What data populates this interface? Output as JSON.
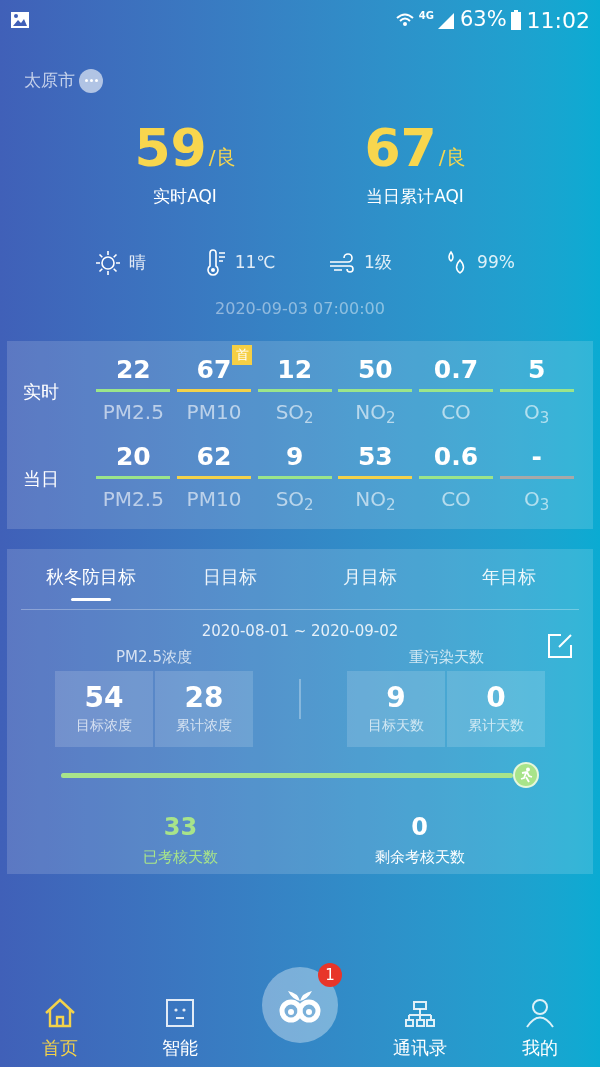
{
  "status_bar": {
    "network": "4G",
    "battery": "63%",
    "time": "11:02"
  },
  "city": {
    "name": "太原市"
  },
  "aqi": [
    {
      "value": "59",
      "grade": "/良",
      "label": "实时AQI"
    },
    {
      "value": "67",
      "grade": "/良",
      "label": "当日累计AQI"
    }
  ],
  "weather": [
    {
      "kind": "sun",
      "text": "晴"
    },
    {
      "kind": "temp",
      "text": "11℃"
    },
    {
      "kind": "wind",
      "text": "1级"
    },
    {
      "kind": "humidity",
      "text": "99%"
    }
  ],
  "timestamp": "2020-09-03 07:00:00",
  "pollutants": [
    {
      "label": "实时",
      "items": [
        {
          "value": "22",
          "name": "PM2.5",
          "color": "#9be58a"
        },
        {
          "value": "67",
          "name": "PM10",
          "color": "#f3d24a",
          "badge": "首"
        },
        {
          "value": "12",
          "name": "SO$_{2}$",
          "color": "#9be58a"
        },
        {
          "value": "50",
          "name": "NO$_{2}$",
          "color": "#9be58a"
        },
        {
          "value": "0.7",
          "name": "CO",
          "color": "#9be58a"
        },
        {
          "value": "5",
          "name": "O$_{3}$",
          "color": "#9be58a"
        }
      ]
    },
    {
      "label": "当日",
      "items": [
        {
          "value": "20",
          "name": "PM2.5",
          "color": "#9be58a"
        },
        {
          "value": "62",
          "name": "PM10",
          "color": "#f3d24a"
        },
        {
          "value": "9",
          "name": "SO$_{2}$",
          "color": "#9be58a"
        },
        {
          "value": "53",
          "name": "NO$_{2}$",
          "color": "#f3d24a"
        },
        {
          "value": "0.6",
          "name": "CO",
          "color": "#9be58a"
        },
        {
          "value": "-",
          "name": "O$_{3}$",
          "color": "#a8a8a8"
        }
      ]
    }
  ],
  "goal_tabs": [
    {
      "label": "秋冬防目标",
      "selected": true
    },
    {
      "label": "日目标",
      "selected": false
    },
    {
      "label": "月目标",
      "selected": false
    },
    {
      "label": "年目标",
      "selected": false
    }
  ],
  "period": "2020-08-01 ~ 2020-09-02",
  "groups": [
    {
      "title": "PM2.5浓度",
      "boxes": [
        {
          "value": "54",
          "label": "目标浓度"
        },
        {
          "value": "28",
          "label": "累计浓度"
        }
      ]
    },
    {
      "title": "重污染天数",
      "boxes": [
        {
          "value": "9",
          "label": "目标天数"
        },
        {
          "value": "0",
          "label": "累计天数"
        }
      ]
    }
  ],
  "progress": {
    "level": 1
  },
  "days": [
    {
      "kind": "done",
      "value": "33",
      "label": "已考核天数"
    },
    {
      "kind": "remaining",
      "value": "0",
      "label": "剩余考核天数"
    }
  ],
  "nav": [
    {
      "kind": "home",
      "label": "首页",
      "selected": true
    },
    {
      "kind": "smart",
      "label": "智能",
      "selected": false
    },
    {
      "kind": "center",
      "badge": "1"
    },
    {
      "kind": "contacts",
      "label": "通讯录",
      "selected": false
    },
    {
      "kind": "me",
      "label": "我的",
      "selected": false
    }
  ]
}
